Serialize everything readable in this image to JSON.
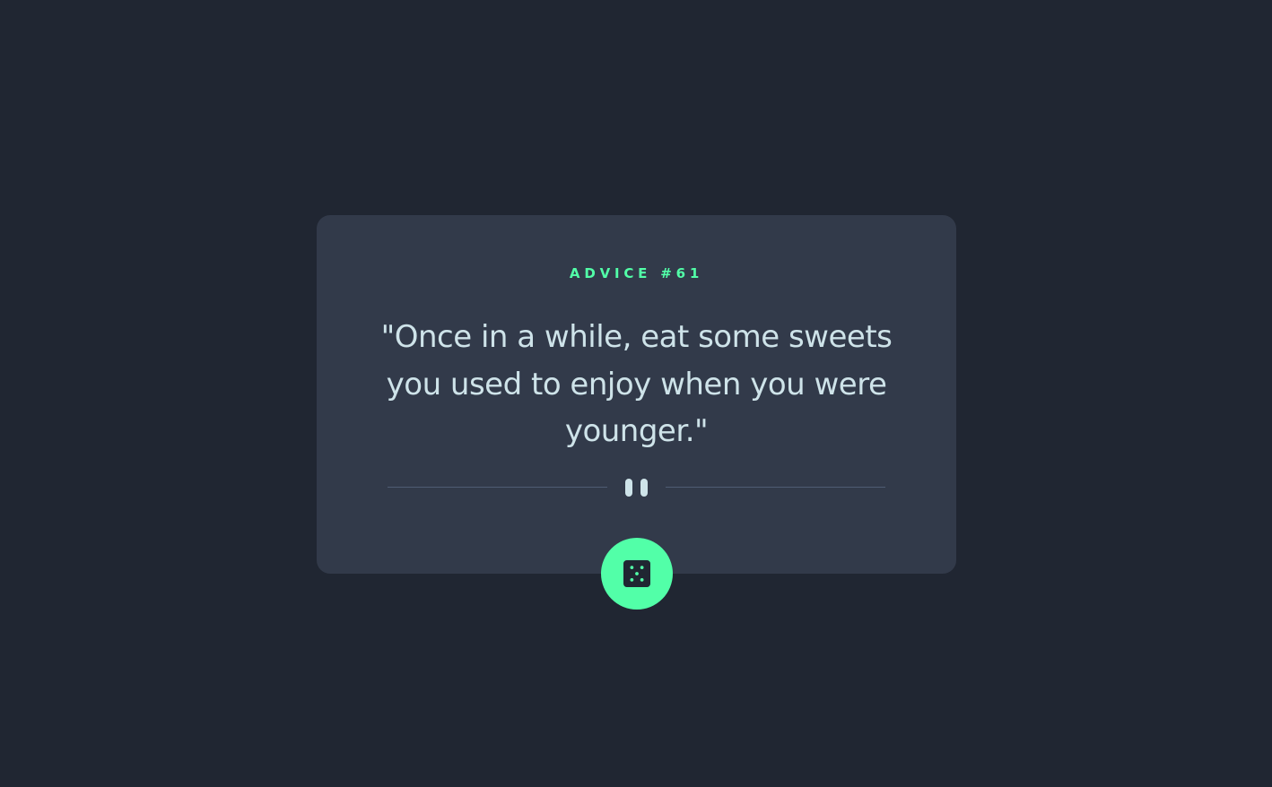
{
  "advice": {
    "id_label": "ADVICE #61",
    "text": "\"Once in a while, eat some sweets you used to enjoy when you were younger.\""
  },
  "divider": {
    "icon": "pause-icon"
  },
  "dice_button": {
    "icon": "dice-icon"
  },
  "colors": {
    "background": "#202632",
    "card": "#323a4a",
    "accent": "#52ffa8",
    "text": "#cee3e9",
    "divider": "#4f5d74"
  }
}
